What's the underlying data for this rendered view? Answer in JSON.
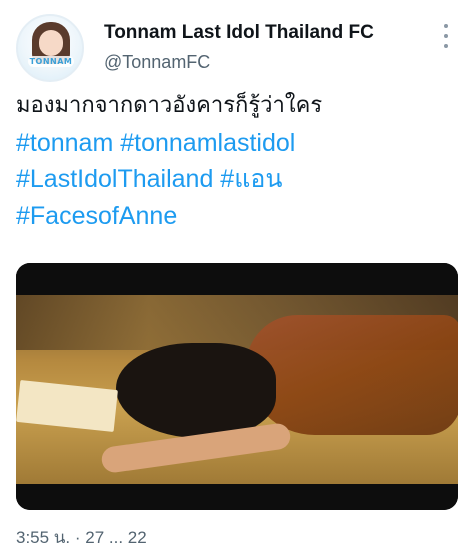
{
  "author": {
    "display_name": "Tonnam Last Idol Thailand FC",
    "handle": "@TonnamFC",
    "avatar_logo_text": "TONNAM"
  },
  "tweet": {
    "text_line": "มองมากจากดาวอังคารก็รู้ว่าใคร",
    "hashtags": {
      "line1": "#tonnam #tonnamlastidol",
      "line2": "#LastIdolThailand #แอน",
      "line3": "#FacesofAnne"
    },
    "timestamp_partial": "3:55 น. · 27 ... 22"
  },
  "icons": {
    "more": "more-vertical-icon"
  },
  "colors": {
    "hashtag": "#1d9bf0",
    "text": "#0f1419",
    "secondary": "#536471"
  }
}
